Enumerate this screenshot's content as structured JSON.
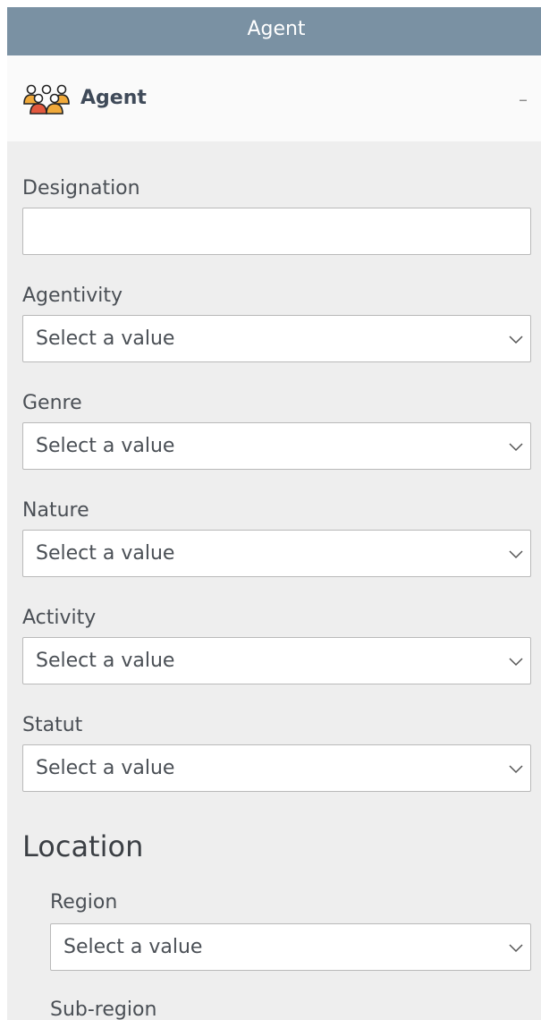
{
  "window": {
    "title": "Agent"
  },
  "panel": {
    "header_title": "Agent",
    "header_icon": "people-group-icon",
    "collapse_symbol": "–"
  },
  "fields": {
    "designation": {
      "label": "Designation",
      "value": "",
      "placeholder": ""
    },
    "agentivity": {
      "label": "Agentivity",
      "value": "Select a value"
    },
    "genre": {
      "label": "Genre",
      "value": "Select a value"
    },
    "nature": {
      "label": "Nature",
      "value": "Select a value"
    },
    "activity": {
      "label": "Activity",
      "value": "Select a value"
    },
    "statut": {
      "label": "Statut",
      "value": "Select a value"
    }
  },
  "location": {
    "title": "Location",
    "region": {
      "label": "Region",
      "value": "Select a value"
    },
    "subregion": {
      "label": "Sub-region"
    }
  },
  "colors": {
    "title_bar": "#7a91a3",
    "panel_background": "#eeeeee",
    "header_background": "#fafafa",
    "icon_orange": "#f0a93a",
    "icon_red": "#e2583e"
  }
}
